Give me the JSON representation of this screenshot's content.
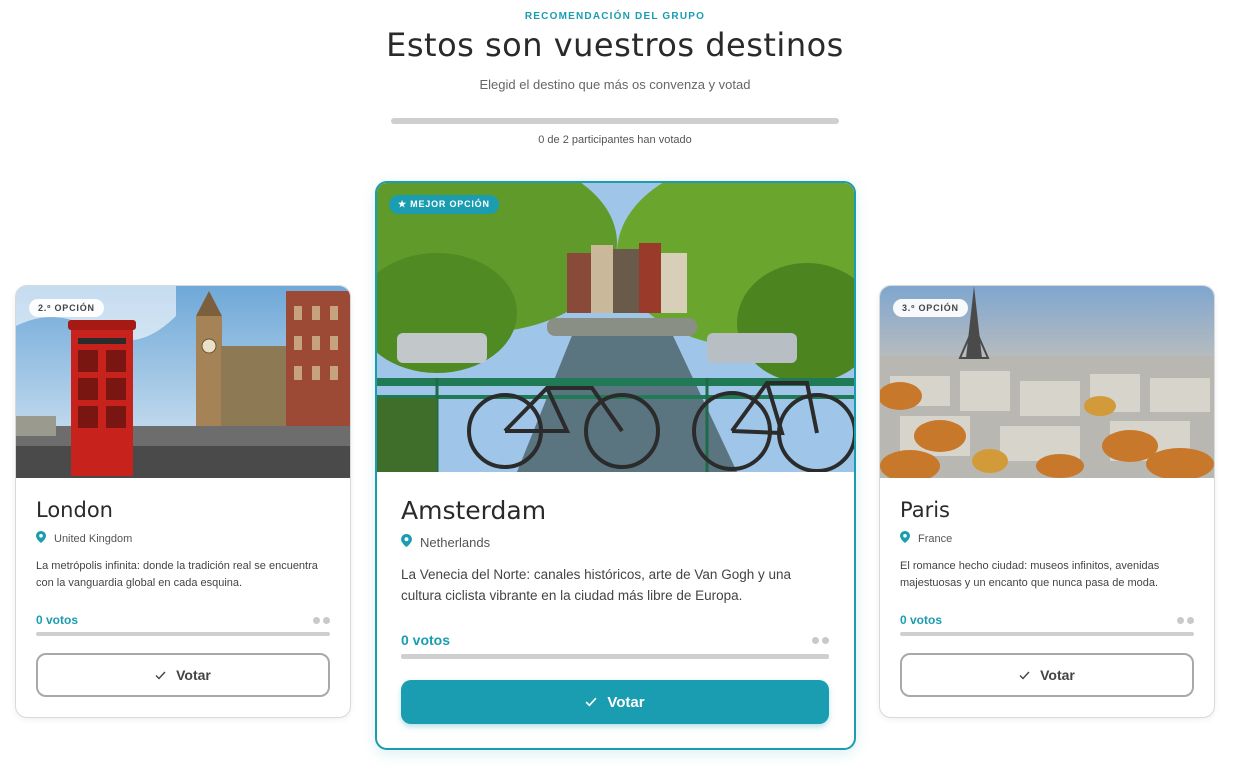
{
  "header": {
    "eyebrow": "RECOMENDACIÓN DEL GRUPO",
    "title": "Estos son vuestros destinos",
    "subtitle": "Elegid el destino que más os convenza y votad",
    "progress_fraction": 0,
    "progress_text": "0 de 2 participantes han votado"
  },
  "colors": {
    "accent": "#1a9db1"
  },
  "cards": [
    {
      "badge": "2.º OPCIÓN",
      "city": "London",
      "country": "United Kingdom",
      "description": "La metrópolis infinita: donde la tradición real se encuentra con la vanguardia global en cada esquina.",
      "votes_label": "0 votos",
      "vote_fraction": 0,
      "button_label": "Votar",
      "icons": {
        "location": "location-pin-icon",
        "check": "check-icon"
      }
    },
    {
      "badge": "★ MEJOR OPCIÓN",
      "city": "Amsterdam",
      "country": "Netherlands",
      "description": "La Venecia del Norte: canales históricos, arte de Van Gogh y una cultura ciclista vibrante en la ciudad más libre de Europa.",
      "votes_label": "0 votos",
      "vote_fraction": 0,
      "button_label": "Votar",
      "icons": {
        "location": "location-pin-icon",
        "check": "check-icon"
      }
    },
    {
      "badge": "3.º OPCIÓN",
      "city": "Paris",
      "country": "France",
      "description": "El romance hecho ciudad: museos infinitos, avenidas majestuosas y un encanto que nunca pasa de moda.",
      "votes_label": "0 votos",
      "vote_fraction": 0,
      "button_label": "Votar",
      "icons": {
        "location": "location-pin-icon",
        "check": "check-icon"
      }
    }
  ]
}
